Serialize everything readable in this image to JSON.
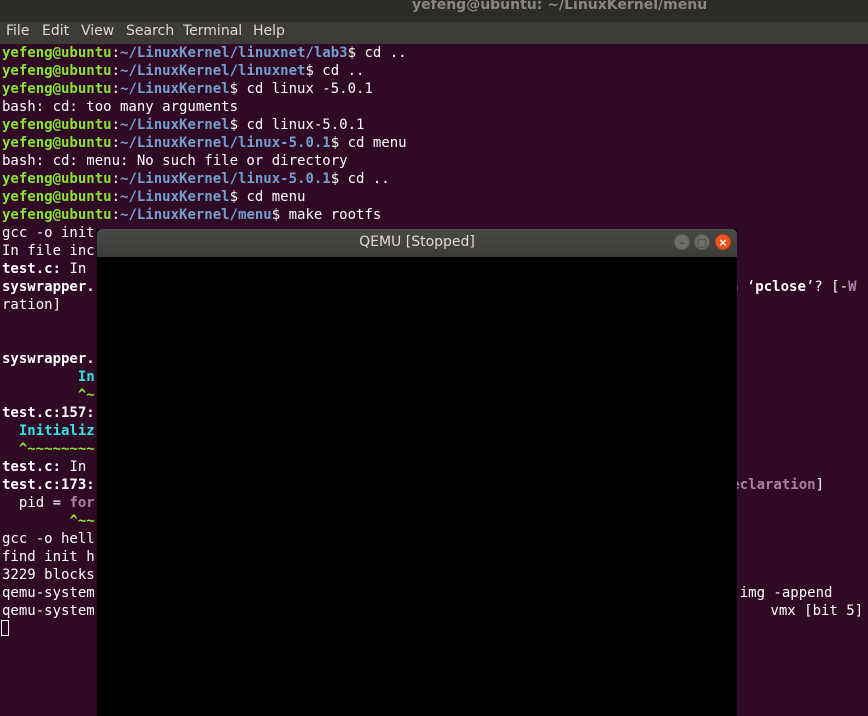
{
  "window": {
    "title": "yefeng@ubuntu: ~/LinuxKernel/menu"
  },
  "menu": [
    "File",
    "Edit",
    "View",
    "Search",
    "Terminal",
    "Help"
  ],
  "prompt_user": "yefeng@ubuntu",
  "lines": [
    {
      "path": "~/LinuxKernel/linuxnet/lab3",
      "cmd": "$ cd .."
    },
    {
      "path": "~/LinuxKernel/linuxnet",
      "cmd": "$ cd .."
    },
    {
      "path": "~/LinuxKernel",
      "cmd": "$ cd linux -5.0.1"
    },
    {
      "text": "bash: cd: too many arguments"
    },
    {
      "path": "~/LinuxKernel",
      "cmd": "$ cd linux-5.0.1"
    },
    {
      "path": "~/LinuxKernel/linux-5.0.1",
      "cmd": "$ cd menu"
    },
    {
      "text": "bash: cd: menu: No such file or directory"
    },
    {
      "path": "~/LinuxKernel/linux-5.0.1",
      "cmd": "$ cd .."
    },
    {
      "path": "~/LinuxKernel",
      "cmd": "$ cd menu"
    },
    {
      "path": "~/LinuxKernel/menu",
      "cmd": "$ make rootfs"
    },
    {
      "text": "gcc -o init"
    },
    {
      "text": "In file inc"
    },
    {
      "bold": "test.c:",
      "text": " In"
    },
    {
      "bold": "syswrapper."
    },
    {
      "text": "ration]"
    },
    {
      "text": ""
    },
    {
      "text": ""
    },
    {
      "bold": "syswrapper."
    },
    {
      "indent": "         ",
      "cyan": "In"
    },
    {
      "indent": "         ",
      "green": "^~"
    },
    {
      "bold": "test.c:157:"
    },
    {
      "indent": "  ",
      "cyan": "Initializ"
    },
    {
      "indent": "  ",
      "green": "^~~~~~~~~"
    },
    {
      "bold": "test.c:",
      "text": " In"
    },
    {
      "bold": "test.c:173:"
    },
    {
      "text": "  pid = ",
      "magenta": "for"
    },
    {
      "indent": "        ",
      "green": "^~~"
    },
    {
      "text": "gcc -o hell"
    },
    {
      "text": "find init h"
    },
    {
      "text": "3229 blocks"
    },
    {
      "text": "qemu-system"
    },
    {
      "text": "qemu-system"
    }
  ],
  "right_fragments": [
    {
      "line": 13,
      "text": "n ‘",
      "bold": "pclose",
      "after": "’? [-",
      "mag": "W"
    },
    {
      "line": 24,
      "mag": "n-declaration",
      "after": "]"
    },
    {
      "line": 30,
      "text": "tfs.img -append"
    },
    {
      "line": 31,
      "text": " vmx [bit 5]"
    }
  ],
  "qemu": {
    "title": "QEMU [Stopped]",
    "buttons": [
      "–",
      "▢",
      "×"
    ]
  }
}
